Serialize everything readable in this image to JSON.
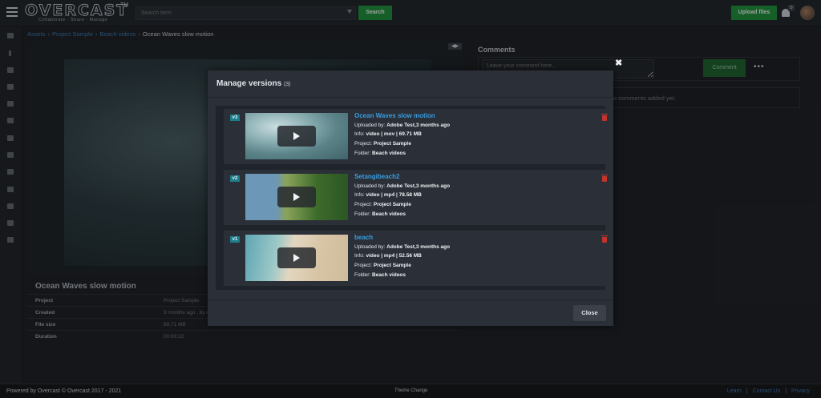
{
  "brand": {
    "name": "OVERCAST",
    "trademark": "TM",
    "tagline": "Collaborate · Share · Manage"
  },
  "search": {
    "placeholder": "Search term",
    "button_label": "Search"
  },
  "header": {
    "upload_label": "Upload files",
    "notification_count": "0"
  },
  "sidebar": {
    "icons": [
      "comments-icon",
      "info-icon",
      "download-icon",
      "mail-icon",
      "check-icon",
      "share-icon",
      "card-icon",
      "video-icon",
      "group-icon",
      "settings-icon",
      "copy-icon",
      "move-icon",
      "trash-icon"
    ]
  },
  "breadcrumb": {
    "items": [
      "Assets",
      "Project Sample",
      "Beach videos"
    ],
    "current": "Ocean Waves slow motion"
  },
  "asset": {
    "title": "Ocean Waves slow motion",
    "details": [
      {
        "key": "Project",
        "value": "Project Sample"
      },
      {
        "key": "Created",
        "value": "3 months ago , by A"
      },
      {
        "key": "File size",
        "value": "69.71 MB"
      },
      {
        "key": "Duration",
        "value": "00:00:22"
      }
    ]
  },
  "comments": {
    "title": "Comments",
    "placeholder": "Leave your comment here...",
    "button_label": "Comment",
    "more_label": "•••",
    "empty_text": "o comments added yet."
  },
  "modal": {
    "title": "Manage versions",
    "count": "(3)",
    "close_label": "Close",
    "versions": [
      {
        "badge": "v3",
        "name": "Ocean Waves slow motion",
        "uploaded_label": "Uploaded by:",
        "uploaded_value": "Adobe Test,3 months ago",
        "info_label": "Info:",
        "info_value": "video | mov | 69.71 MB",
        "project_label": "Project:",
        "project_value": "Project Sample",
        "folder_label": "Folder:",
        "folder_value": "Beach videos"
      },
      {
        "badge": "v2",
        "name": "Setangibeach2",
        "uploaded_label": "Uploaded by:",
        "uploaded_value": "Adobe Test,3 months ago",
        "info_label": "Info:",
        "info_value": "video | mp4 | 78.58 MB",
        "project_label": "Project:",
        "project_value": "Project Sample",
        "folder_label": "Folder:",
        "folder_value": "Beach videos"
      },
      {
        "badge": "v1",
        "name": "beach",
        "uploaded_label": "Uploaded by:",
        "uploaded_value": "Adobe Test,3 months ago",
        "info_label": "Info:",
        "info_value": "video | mp4 | 52.56 MB",
        "project_label": "Project:",
        "project_value": "Project Sample",
        "folder_label": "Folder:",
        "folder_value": "Beach videos"
      }
    ]
  },
  "footer": {
    "left": "Powered by Overcast  ©  Overcast  2017 - 2021",
    "theme": "Theme Change",
    "links": [
      "Learn",
      "Contact Us",
      "Privacy"
    ]
  }
}
